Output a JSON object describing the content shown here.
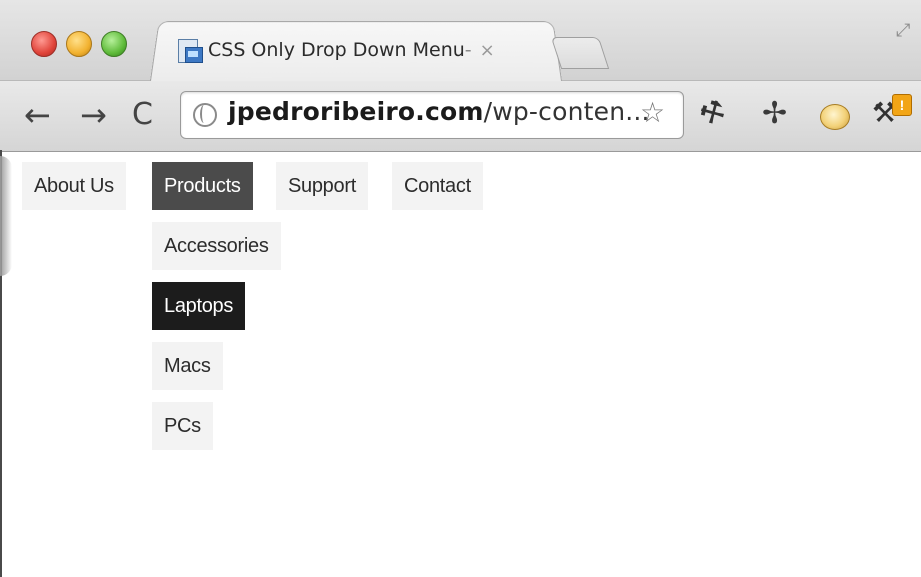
{
  "browser": {
    "tab_title_main": "CSS Only Drop Down Menu",
    "tab_title_fade": " - ",
    "tab_close": "×",
    "url_domain": "jpedroribeiro.com",
    "url_path": "/wp-conten...",
    "icons": [
      "back-arrow-icon",
      "forward-arrow-icon",
      "reload-icon",
      "globe-icon",
      "star-icon",
      "wrench-icon",
      "pin-icon",
      "cookie-icon",
      "settings-wrench-icon",
      "resize-icon"
    ],
    "colors": {
      "badge": "#f2a516",
      "close": "#e0443a",
      "minimize": "#f2b230",
      "maximize": "#5fbb3a"
    }
  },
  "menu": {
    "items": [
      {
        "label": "About Us"
      },
      {
        "label": "Products"
      },
      {
        "label": "Support"
      },
      {
        "label": "Contact"
      }
    ],
    "submenu": [
      {
        "label": "Accessories"
      },
      {
        "label": "Laptops"
      },
      {
        "label": "Macs"
      },
      {
        "label": "PCs"
      }
    ],
    "colors": {
      "item_bg": "#f3f3f3",
      "active_bg": "#4b4b4b",
      "hover_bg": "#1c1c1c"
    }
  },
  "glyphs": {
    "back": "←",
    "forward": "→",
    "reload": "C",
    "star": "☆",
    "pin": "✢",
    "wrench": "⚒",
    "resize": "⤢",
    "badge": "!"
  }
}
